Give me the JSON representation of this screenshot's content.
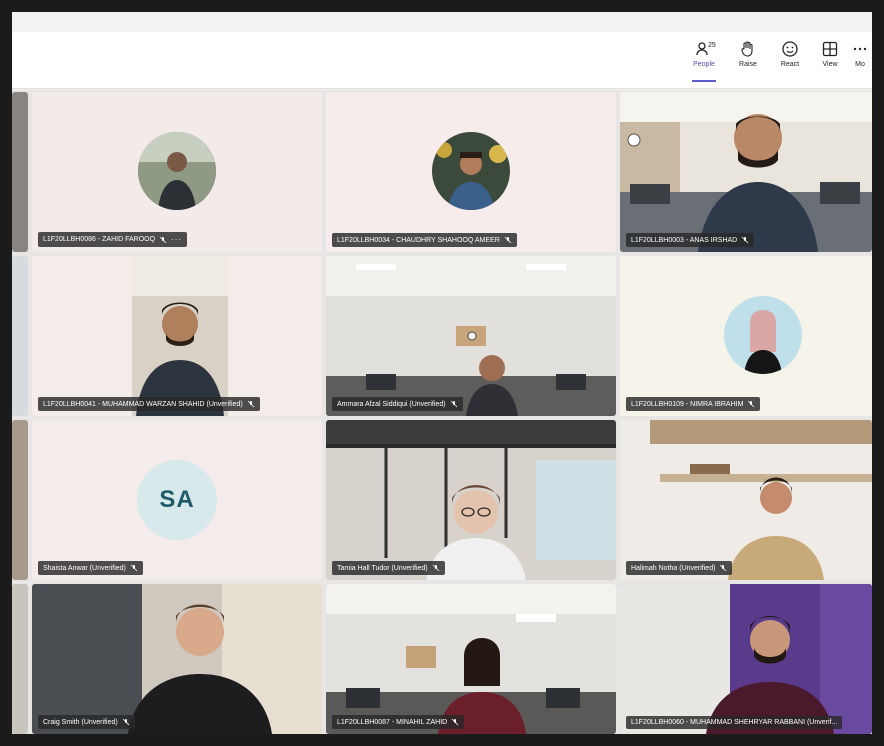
{
  "toolbar": {
    "people": {
      "label": "People",
      "count": "25"
    },
    "raise": {
      "label": "Raise"
    },
    "react": {
      "label": "React"
    },
    "view": {
      "label": "View"
    },
    "more": {
      "label": "Mo"
    }
  },
  "tiles": [
    {
      "name": "L1F20LLBH0086 - ZAHID FAROOQ",
      "muted": true,
      "more": "···"
    },
    {
      "name": "L1F20LLBH0034 - CHAUDHRY SHAHOOQ AMEER",
      "muted": true
    },
    {
      "name": "L1F20LLBH0003 - ANAS IRSHAD",
      "muted": true
    },
    {
      "name": "L1F20LLBH0041 - MUHAMMAD WARZAN SHAHID (Unverified)",
      "muted": true
    },
    {
      "name": "Ammara Afzal Siddiqui (Unverified)",
      "muted": true
    },
    {
      "name": "L1F20LLBH0109 - NIMRA IBRAHIM",
      "muted": true
    },
    {
      "name": "Shaista Anwar (Unverified)",
      "muted": true,
      "initials": "SA"
    },
    {
      "name": "Tamia Hall Tudor (Unverified)",
      "muted": true
    },
    {
      "name": "Halimah Notha (Unverified)",
      "muted": true
    },
    {
      "name": "Craig Smith (Unverified)",
      "muted": true
    },
    {
      "name": "L1F20LLBH0087 - MINAHIL ZAHID",
      "muted": true
    },
    {
      "name": "L1F20LLBH0060 - MUHAMMAD SHEHRYAR RABBANI (Unverif...",
      "muted": true
    }
  ],
  "colors": {
    "accent": "#5b5fc7",
    "tile_bg": "#f4ebe8",
    "name_tag_bg": "#282828"
  }
}
